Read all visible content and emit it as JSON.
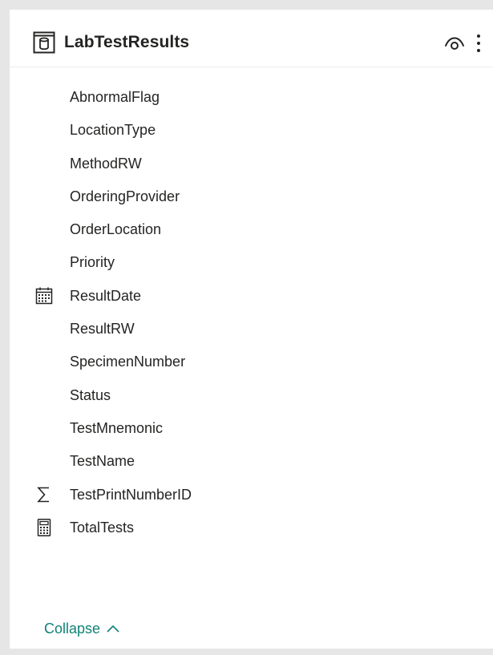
{
  "table": {
    "title": "LabTestResults",
    "icons": {
      "table": "table-cylinder-icon",
      "visibility": "eye-icon",
      "more": "more-vertical-icon"
    }
  },
  "fields": [
    {
      "label": "AbnormalFlag",
      "icon": ""
    },
    {
      "label": "LocationType",
      "icon": ""
    },
    {
      "label": "MethodRW",
      "icon": ""
    },
    {
      "label": "OrderingProvider",
      "icon": ""
    },
    {
      "label": "OrderLocation",
      "icon": ""
    },
    {
      "label": "Priority",
      "icon": ""
    },
    {
      "label": "ResultDate",
      "icon": "calendar-icon"
    },
    {
      "label": "ResultRW",
      "icon": ""
    },
    {
      "label": "SpecimenNumber",
      "icon": ""
    },
    {
      "label": "Status",
      "icon": ""
    },
    {
      "label": "TestMnemonic",
      "icon": ""
    },
    {
      "label": "TestName",
      "icon": ""
    },
    {
      "label": "TestPrintNumberID",
      "icon": "sigma-icon"
    },
    {
      "label": "TotalTests",
      "icon": "calculator-icon"
    }
  ],
  "footer": {
    "collapse_label": "Collapse"
  },
  "colors": {
    "text": "#252423",
    "accent": "#118276",
    "background": "#e6e6e6",
    "card": "#ffffff"
  }
}
